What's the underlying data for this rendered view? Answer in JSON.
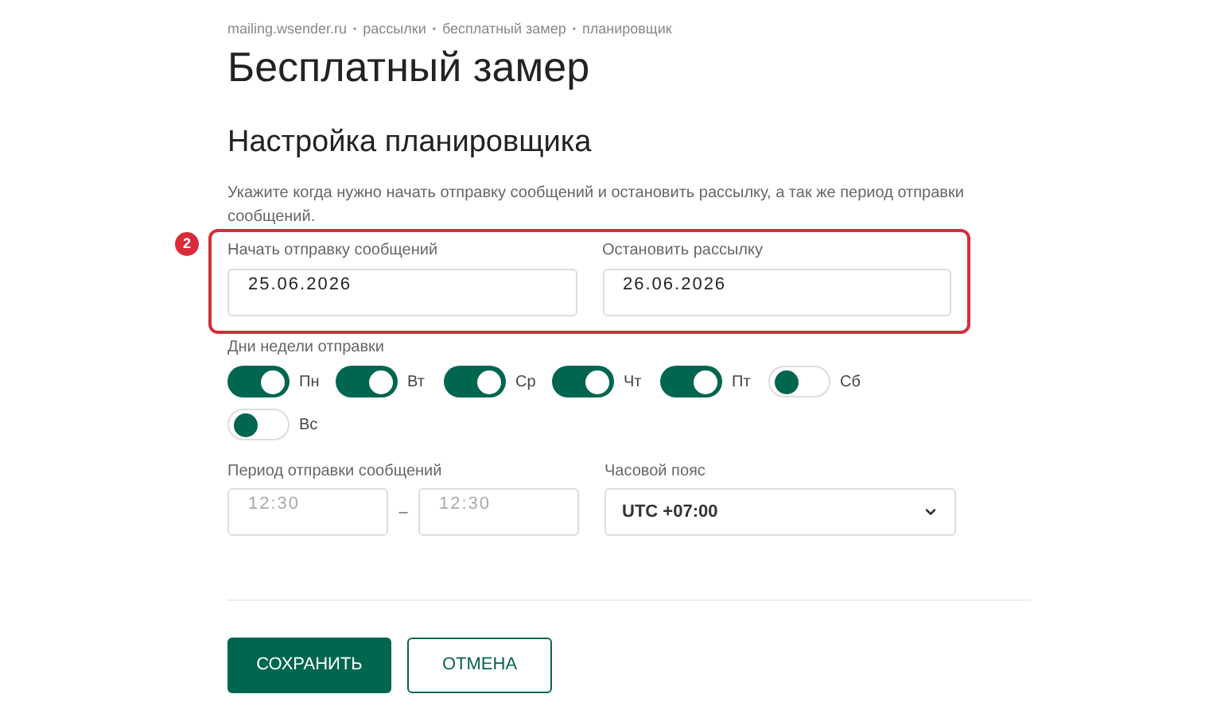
{
  "breadcrumb": {
    "items": [
      "mailing.wsender.ru",
      "рассылки",
      "бесплатный замер",
      "планировщик"
    ],
    "separator": "•"
  },
  "title": "Бесплатный замер",
  "section_title": "Настройка планировщика",
  "description": "Укажите когда нужно начать отправку сообщений и остановить рассылку, а так же период отправки сообщений.",
  "annotation_badge": "2",
  "date_fields": [
    {
      "label": "Начать отправку сообщений",
      "value": "25.06.2026"
    },
    {
      "label": "Остановить рассылку",
      "value": "26.06.2026"
    }
  ],
  "weekdays": {
    "label": "Дни недели отправки",
    "days": [
      {
        "label": "Пн",
        "on": true
      },
      {
        "label": "Вт",
        "on": true
      },
      {
        "label": "Ср",
        "on": true
      },
      {
        "label": "Чт",
        "on": true
      },
      {
        "label": "Пт",
        "on": true
      },
      {
        "label": "Сб",
        "on": false
      },
      {
        "label": "Вс",
        "on": false
      }
    ]
  },
  "period": {
    "label": "Период отправки сообщений",
    "from_placeholder": "12:30",
    "separator": "–",
    "to_placeholder": "12:30"
  },
  "timezone": {
    "label": "Часовой пояс",
    "value": "UTC +07:00"
  },
  "buttons": [
    {
      "label": "СОХРАНИТЬ",
      "kind": "primary"
    },
    {
      "label": "ОТМЕНА",
      "kind": "secondary"
    }
  ]
}
